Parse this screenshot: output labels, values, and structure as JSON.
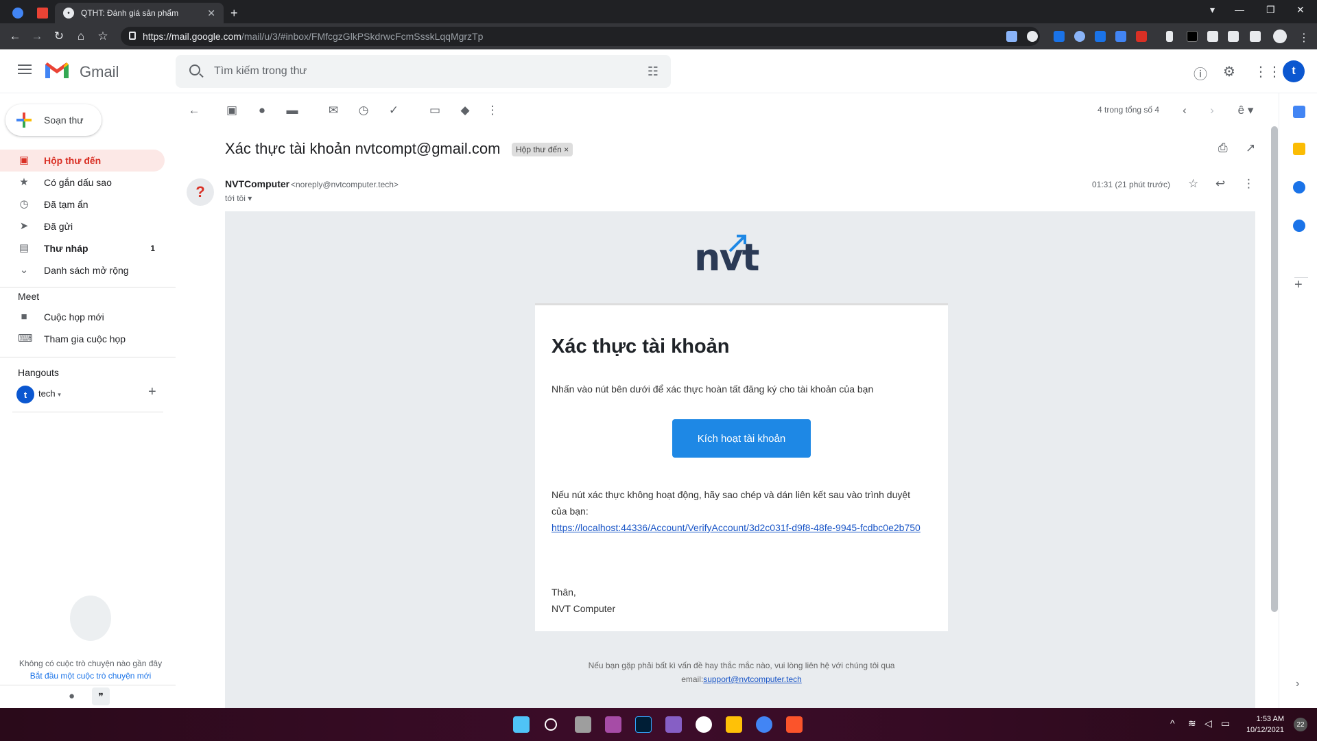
{
  "browser": {
    "tab_title": "QTHT: Đánh giá sản phẩm",
    "url_host": "https://mail.google.com",
    "url_path": "/mail/u/3/#inbox/FMfcgzGlkPSkdrwcFcmSsskLqqMgrzTp"
  },
  "gmail": {
    "brand": "Gmail",
    "search_placeholder": "Tìm kiếm trong thư",
    "account_initial": "t"
  },
  "sidebar": {
    "compose_label": "Soạn thư",
    "items": [
      {
        "label": "Hộp thư đến",
        "icon": "inbox-icon"
      },
      {
        "label": "Có gắn dấu sao",
        "icon": "star-icon"
      },
      {
        "label": "Đã tạm ẩn",
        "icon": "clock-icon"
      },
      {
        "label": "Đã gửi",
        "icon": "send-icon"
      },
      {
        "label": "Thư nháp",
        "icon": "draft-icon",
        "count": "1"
      },
      {
        "label": "Danh sách mở rộng",
        "icon": "chevron-down-icon"
      }
    ],
    "meet_heading": "Meet",
    "meet_items": [
      "Cuộc họp mới",
      "Tham gia cuộc họp"
    ],
    "hangouts_heading": "Hangouts",
    "hangouts_user": "tech",
    "hangouts_initial": "t",
    "no_chats": "Không có cuộc trò chuyện nào gần đây",
    "start_chat": "Bắt đầu một cuộc trò chuyện mới"
  },
  "toolbar": {
    "pager": "4 trong tổng số 4"
  },
  "email": {
    "subject": "Xác thực tài khoản nvtcompt@gmail.com",
    "label_chip": "Hộp thư đến",
    "sender_name": "NVTComputer",
    "sender_email": "<noreply@nvtcomputer.tech>",
    "to_line": "tới tôi",
    "time": "01:31 (21 phút trước)",
    "logo_text": "nvt",
    "heading": "Xác thực tài khoản",
    "intro": "Nhấn vào nút bên dưới để xác thực hoàn tất đăng ký cho tài khoản của bạn",
    "button_label": "Kích hoạt tài khoản",
    "fallback_text": "Nếu nút xác thực không hoạt động, hãy sao chép và dán liên kết sau vào trình duyệt của bạn:",
    "verify_link": "https://localhost:44336/Account/VerifyAccount/3d2c031f-d9f8-48fe-9945-fcdbc0e2b750",
    "sign_off": "Thân,",
    "sign_name": "NVT Computer",
    "footer_text": "Nếu bạn gặp phải bất kì vấn đề hay thắc mắc nào, vui lòng liên hệ với chúng tôi qua email:",
    "footer_email": "support@nvtcomputer.tech"
  },
  "taskbar": {
    "time": "1:53 AM",
    "date": "10/12/2021",
    "notifications": "22"
  },
  "colors": {
    "accent_button": "#1e88e5",
    "active_nav": "#fce8e6",
    "active_text": "#d93025",
    "account_avatar": "#0b57d0"
  }
}
